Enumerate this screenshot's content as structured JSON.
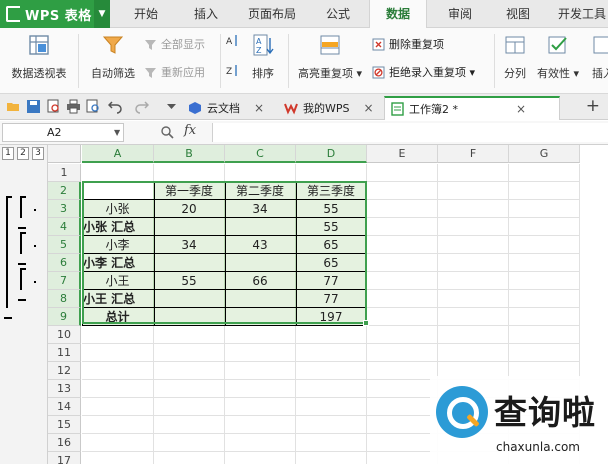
{
  "app": {
    "name": "WPS 表格",
    "brand_color": "#2f9e44",
    "logo_icon": "wps-logo-icon",
    "menu_tabs": [
      "开始",
      "插入",
      "页面布局",
      "公式",
      "数据",
      "审阅",
      "视图",
      "开发工具"
    ],
    "active_tab": "数据"
  },
  "ribbon": {
    "pivot": {
      "label": "数据透视表",
      "icon": "pivot-table-icon"
    },
    "autofilter": {
      "label": "自动筛选",
      "icon": "funnel-icon"
    },
    "show_all": {
      "label": "全部显示",
      "icon": "filter-clear-icon"
    },
    "reapply": {
      "label": "重新应用",
      "icon": "filter-reapply-icon"
    },
    "sort_icons": {
      "asc": "sort-ascending-icon",
      "desc": "sort-descending-icon"
    },
    "sort": {
      "label": "排序",
      "icon": "sort-az-icon"
    },
    "highlight_dup": {
      "label": "高亮重复项",
      "icon": "highlight-duplicates-icon"
    },
    "delete_dup": {
      "label": "删除重复项",
      "icon": "delete-duplicates-icon"
    },
    "reject_dup": {
      "label": "拒绝录入重复项",
      "icon": "reject-duplicates-icon"
    },
    "split": {
      "label": "分列",
      "icon": "split-columns-icon"
    },
    "validity": {
      "label": "有效性",
      "icon": "validation-icon"
    },
    "insert": {
      "label": "插入"
    }
  },
  "quick_access": [
    "open-folder-icon",
    "save-icon",
    "print-preview-icon",
    "print-icon",
    "find-icon",
    "undo-icon",
    "redo-icon",
    "customize-arrow-icon"
  ],
  "doc_tabs": [
    {
      "label": "云文档",
      "icon": "cloud-docs-icon",
      "close": "×"
    },
    {
      "label": "我的WPS",
      "icon": "wps-home-icon",
      "close": "×"
    },
    {
      "label": "工作簿2 *",
      "icon": "workbook-icon",
      "close": "×"
    }
  ],
  "new_tab": "+",
  "formula_bar": {
    "name_box": "A2",
    "fx": "fx",
    "formula": ""
  },
  "outline": {
    "levels": [
      "1",
      "2",
      "3"
    ]
  },
  "sheet": {
    "columns": [
      "A",
      "B",
      "C",
      "D",
      "E",
      "F",
      "G"
    ],
    "rows": [
      "1",
      "2",
      "3",
      "4",
      "5",
      "6",
      "7",
      "8",
      "9",
      "10",
      "11",
      "12",
      "13",
      "14",
      "15",
      "16",
      "17"
    ],
    "cells": {
      "B2": "第一季度",
      "C2": "第二季度",
      "D2": "第三季度",
      "A3": "小张",
      "B3": "20",
      "C3": "34",
      "D3": "55",
      "A4": "小张 汇总",
      "D4": "55",
      "A5": "小李",
      "B5": "34",
      "C5": "43",
      "D5": "65",
      "A6": "小李 汇总",
      "D6": "65",
      "A7": "小王",
      "B7": "55",
      "C7": "66",
      "D7": "77",
      "A8": "小王 汇总",
      "D8": "77",
      "A9": "总计",
      "D9": "197"
    }
  },
  "watermark": {
    "title": "查询啦",
    "url": "chaxunla.com",
    "icon": "chaxunla-logo-icon"
  }
}
